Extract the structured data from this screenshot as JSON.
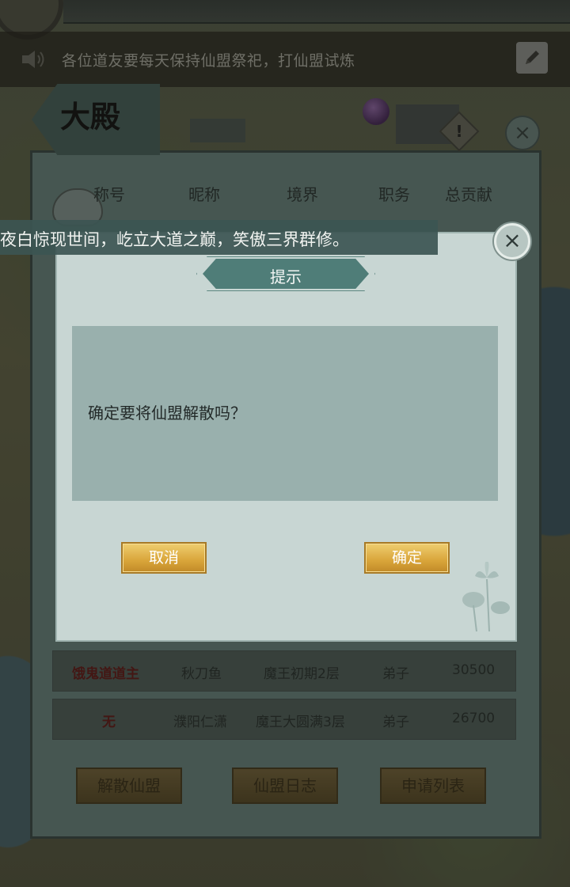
{
  "announcement": {
    "text": "各位道友要每天保持仙盟祭祀，打仙盟试炼"
  },
  "hall": {
    "title": "大殿",
    "columns": [
      "称号",
      "昵称",
      "境界",
      "职务",
      "总贡献"
    ],
    "rows": [
      {
        "title": "饿鬼道道主",
        "nickname": "秋刀鱼",
        "realm": "魔王初期2层",
        "role": "弟子",
        "contribution": "30500"
      },
      {
        "title": "无",
        "nickname": "濮阳仁潇",
        "realm": "魔王大圆满3层",
        "role": "弟子",
        "contribution": "26700"
      }
    ],
    "buttons": {
      "dissolve": "解散仙盟",
      "log": "仙盟日志",
      "applications": "申请列表"
    }
  },
  "scroll_message": "夜白惊现世间，屹立大道之巅，笑傲三界群修。",
  "dialog": {
    "title": "提示",
    "message": "确定要将仙盟解散吗？",
    "cancel_label": "取消",
    "confirm_label": "确定"
  },
  "icons": {
    "speaker": "speaker-icon",
    "edit": "pencil-icon",
    "close": "close-icon",
    "alert": "exclamation-icon",
    "teapot": "teapot-icon",
    "lotus": "lotus-icon"
  },
  "colors": {
    "dialog_bg": "#c8d6d3",
    "dialog_body": "#99b0ad",
    "header_teal": "#4f7d78",
    "gold_button": "#d9a53a",
    "title_red": "#6a1a18"
  }
}
